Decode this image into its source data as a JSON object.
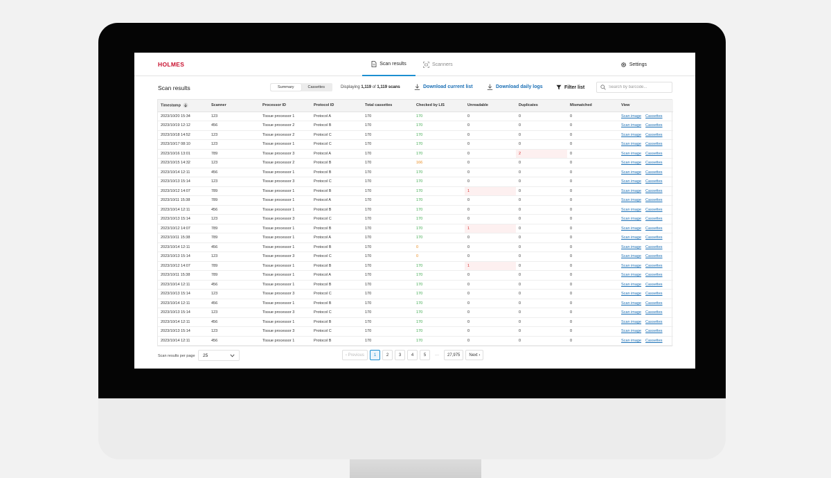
{
  "brand": {
    "logo": "HOLMES",
    "accent": "#c8102e",
    "link_color": "#1a6fb5"
  },
  "nav": {
    "tabs": [
      {
        "label": "Scan results",
        "icon": "document-icon",
        "active": true
      },
      {
        "label": "Scanners",
        "icon": "scanner-icon",
        "active": false
      }
    ],
    "settings_label": "Settings"
  },
  "toolbar": {
    "title": "Scan results",
    "segments": [
      "Summary",
      "Cassettes"
    ],
    "active_segment": "Summary",
    "display_prefix": "Displaying",
    "display_shown": "1,119",
    "display_of": "of",
    "display_total": "1,119 scans",
    "download_current": "Download current list",
    "download_daily": "Download daily logs",
    "filter": "Filter list",
    "search_placeholder": "Search by barcode..."
  },
  "table": {
    "columns": [
      "Timestamp",
      "Scanner",
      "Processor ID",
      "Protocol ID",
      "Total cassettes",
      "Checked by LIS",
      "Unreadable",
      "Duplicates",
      "Mismatched",
      "View"
    ],
    "sorted_column": "Timestamp",
    "link_scan": "Scan image",
    "link_cassettes": "Cassettes",
    "rows": [
      {
        "ts": "2023/10/20 15:34",
        "scanner": "123",
        "proc": "Tissue processor 1",
        "proto": "Protocol A",
        "total": "170",
        "lis": "170",
        "lis_status": "ok",
        "unread": "0",
        "dup": "0",
        "mis": "0"
      },
      {
        "ts": "2023/10/19 12:12",
        "scanner": "456",
        "proc": "Tissue processor 2",
        "proto": "Protocol B",
        "total": "170",
        "lis": "170",
        "lis_status": "ok",
        "unread": "0",
        "dup": "0",
        "mis": "0"
      },
      {
        "ts": "2023/10/18 14:52",
        "scanner": "123",
        "proc": "Tissue processor 2",
        "proto": "Protocol C",
        "total": "170",
        "lis": "170",
        "lis_status": "ok",
        "unread": "0",
        "dup": "0",
        "mis": "0"
      },
      {
        "ts": "2023/10/17 08:10",
        "scanner": "123",
        "proc": "Tissue processor 1",
        "proto": "Protocol C",
        "total": "170",
        "lis": "170",
        "lis_status": "ok",
        "unread": "0",
        "dup": "0",
        "mis": "0"
      },
      {
        "ts": "2023/10/16 13:01",
        "scanner": "789",
        "proc": "Tissue processor 3",
        "proto": "Protocol A",
        "total": "170",
        "lis": "170",
        "lis_status": "ok",
        "unread": "0",
        "dup": "2",
        "mis": "0",
        "dup_flag": true
      },
      {
        "ts": "2023/10/15 14:32",
        "scanner": "123",
        "proc": "Tissue processor 2",
        "proto": "Protocol B",
        "total": "170",
        "lis": "166",
        "lis_status": "warn",
        "unread": "0",
        "dup": "0",
        "mis": "0"
      },
      {
        "ts": "2023/10/14 12:11",
        "scanner": "456",
        "proc": "Tissue processor 1",
        "proto": "Protocol B",
        "total": "170",
        "lis": "170",
        "lis_status": "ok",
        "unread": "0",
        "dup": "0",
        "mis": "0"
      },
      {
        "ts": "2023/10/13 15:14",
        "scanner": "123",
        "proc": "Tissue processor 3",
        "proto": "Protocol C",
        "total": "170",
        "lis": "170",
        "lis_status": "ok",
        "unread": "0",
        "dup": "0",
        "mis": "0"
      },
      {
        "ts": "2023/10/12 14:07",
        "scanner": "789",
        "proc": "Tissue processor 1",
        "proto": "Protocol B",
        "total": "170",
        "lis": "170",
        "lis_status": "ok",
        "unread": "1",
        "dup": "0",
        "mis": "0",
        "unread_flag": true
      },
      {
        "ts": "2023/10/11 15:38",
        "scanner": "789",
        "proc": "Tissue processor 1",
        "proto": "Protocol A",
        "total": "170",
        "lis": "170",
        "lis_status": "ok",
        "unread": "0",
        "dup": "0",
        "mis": "0"
      },
      {
        "ts": "2023/10/14 12:11",
        "scanner": "456",
        "proc": "Tissue processor 1",
        "proto": "Protocol B",
        "total": "170",
        "lis": "170",
        "lis_status": "ok",
        "unread": "0",
        "dup": "0",
        "mis": "0"
      },
      {
        "ts": "2023/10/13 15:14",
        "scanner": "123",
        "proc": "Tissue processor 3",
        "proto": "Protocol C",
        "total": "170",
        "lis": "170",
        "lis_status": "ok",
        "unread": "0",
        "dup": "0",
        "mis": "0"
      },
      {
        "ts": "2023/10/12 14:07",
        "scanner": "789",
        "proc": "Tissue processor 1",
        "proto": "Protocol B",
        "total": "170",
        "lis": "170",
        "lis_status": "ok",
        "unread": "1",
        "dup": "0",
        "mis": "0",
        "unread_flag": true
      },
      {
        "ts": "2023/10/11 15:38",
        "scanner": "789",
        "proc": "Tissue processor 1",
        "proto": "Protocol A",
        "total": "170",
        "lis": "170",
        "lis_status": "ok",
        "unread": "0",
        "dup": "0",
        "mis": "0"
      },
      {
        "ts": "2023/10/14 12:11",
        "scanner": "456",
        "proc": "Tissue processor 1",
        "proto": "Protocol B",
        "total": "170",
        "lis": "0",
        "lis_status": "warn",
        "unread": "0",
        "dup": "0",
        "mis": "0"
      },
      {
        "ts": "2023/10/13 15:14",
        "scanner": "123",
        "proc": "Tissue processor 3",
        "proto": "Protocol C",
        "total": "170",
        "lis": "0",
        "lis_status": "warn",
        "unread": "0",
        "dup": "0",
        "mis": "0"
      },
      {
        "ts": "2023/10/12 14:07",
        "scanner": "789",
        "proc": "Tissue processor 1",
        "proto": "Protocol B",
        "total": "170",
        "lis": "170",
        "lis_status": "ok",
        "unread": "1",
        "dup": "0",
        "mis": "0",
        "unread_flag": true
      },
      {
        "ts": "2023/10/11 15:38",
        "scanner": "789",
        "proc": "Tissue processor 1",
        "proto": "Protocol A",
        "total": "170",
        "lis": "170",
        "lis_status": "ok",
        "unread": "0",
        "dup": "0",
        "mis": "0"
      },
      {
        "ts": "2023/10/14 12:11",
        "scanner": "456",
        "proc": "Tissue processor 1",
        "proto": "Protocol B",
        "total": "170",
        "lis": "170",
        "lis_status": "ok",
        "unread": "0",
        "dup": "0",
        "mis": "0"
      },
      {
        "ts": "2023/10/13 15:14",
        "scanner": "123",
        "proc": "Tissue processor 3",
        "proto": "Protocol C",
        "total": "170",
        "lis": "170",
        "lis_status": "ok",
        "unread": "0",
        "dup": "0",
        "mis": "0"
      },
      {
        "ts": "2023/10/14 12:11",
        "scanner": "456",
        "proc": "Tissue processor 1",
        "proto": "Protocol B",
        "total": "170",
        "lis": "170",
        "lis_status": "ok",
        "unread": "0",
        "dup": "0",
        "mis": "0"
      },
      {
        "ts": "2023/10/13 15:14",
        "scanner": "123",
        "proc": "Tissue processor 3",
        "proto": "Protocol C",
        "total": "170",
        "lis": "170",
        "lis_status": "ok",
        "unread": "0",
        "dup": "0",
        "mis": "0"
      },
      {
        "ts": "2023/10/14 12:11",
        "scanner": "456",
        "proc": "Tissue processor 1",
        "proto": "Protocol B",
        "total": "170",
        "lis": "170",
        "lis_status": "ok",
        "unread": "0",
        "dup": "0",
        "mis": "0"
      },
      {
        "ts": "2023/10/13 15:14",
        "scanner": "123",
        "proc": "Tissue processor 3",
        "proto": "Protocol C",
        "total": "170",
        "lis": "170",
        "lis_status": "ok",
        "unread": "0",
        "dup": "0",
        "mis": "0"
      },
      {
        "ts": "2023/10/14 12:11",
        "scanner": "456",
        "proc": "Tissue processor 1",
        "proto": "Protocol B",
        "total": "170",
        "lis": "170",
        "lis_status": "ok",
        "unread": "0",
        "dup": "0",
        "mis": "0"
      }
    ]
  },
  "footer": {
    "per_page_label": "Scan results per page",
    "per_page_value": "25",
    "prev": "Previous",
    "pages": [
      "1",
      "2",
      "3",
      "4",
      "5"
    ],
    "current_page": "1",
    "ellipsis": "···",
    "last_page": "27,975",
    "next": "Next"
  },
  "status_colors": {
    "ok": "#3aa84a",
    "warn": "#e98a1c",
    "error": "#d62e2e"
  }
}
